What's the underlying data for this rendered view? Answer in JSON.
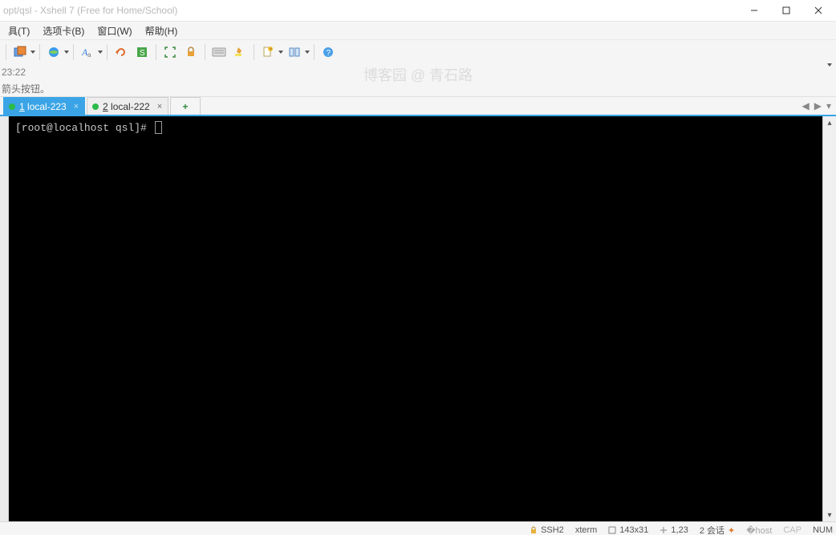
{
  "window": {
    "title": "opt/qsl - Xshell 7 (Free for Home/School)"
  },
  "menus": {
    "tools": "具(T)",
    "tabs": "选项卡(B)",
    "window": "窗口(W)",
    "help": "帮助(H)"
  },
  "address": {
    "text": "23:22"
  },
  "hint": {
    "text": "箭头按钮。"
  },
  "watermark": "博客园 @ 青石路",
  "tabs": [
    {
      "index_label": "1",
      "label": "local-223",
      "active": true
    },
    {
      "index_label": "2",
      "label": "local-222",
      "active": false
    }
  ],
  "newtab_label": "+",
  "terminal": {
    "prompt": "[root@localhost qsl]# "
  },
  "status": {
    "conn": "SSH2",
    "term": "xterm",
    "size": "143x31",
    "cursor": "1,23",
    "sessions": "2 会话",
    "cap": "CAP",
    "num": "NUM"
  },
  "tabnav": {
    "left": "◀",
    "right": "▶",
    "menu": "▾"
  }
}
